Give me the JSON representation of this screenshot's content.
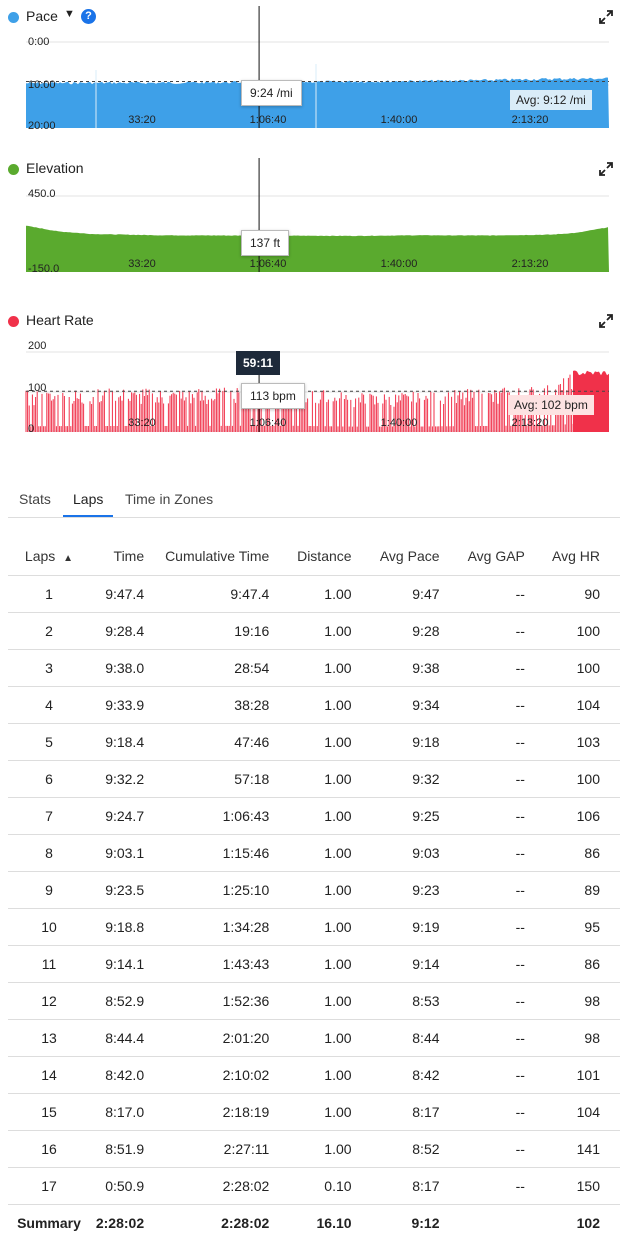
{
  "charts": {
    "pace": {
      "title": "Pace",
      "y_top": "0:00",
      "y_mid": "10:00",
      "y_bottom": "20:00",
      "tooltip": "9:24 /mi",
      "avg": "Avg: 9:12 /mi",
      "color": "#3ea0e8"
    },
    "elevation": {
      "title": "Elevation",
      "y_top": "450.0",
      "y_bottom": "-150.0",
      "tooltip": "137 ft",
      "color": "#5aaa2e"
    },
    "heart_rate": {
      "title": "Heart Rate",
      "y_top": "200",
      "y_mid": "100",
      "y_bottom": "0",
      "tooltip": "113 bpm",
      "avg": "Avg: 102 bpm",
      "cursor_time": "59:11",
      "color": "#f0314a"
    },
    "x_ticks": [
      "33:20",
      "1:06:40",
      "1:40:00",
      "2:13:20"
    ]
  },
  "chart_data": [
    {
      "type": "area",
      "title": "Pace",
      "ylabel": "",
      "ylim": [
        "0:00",
        "20:00"
      ],
      "y_ticks": [
        "0:00",
        "10:00",
        "20:00"
      ],
      "x_ticks": [
        "33:20",
        "1:06:40",
        "1:40:00",
        "2:13:20"
      ],
      "x_range": [
        "0:00",
        "2:28:02"
      ],
      "cursor_time": "59:11",
      "cursor_value": "9:24 /mi",
      "average": "9:12 /mi",
      "series": [
        {
          "name": "Pace",
          "x": [
            "0:00",
            "16:40",
            "33:20",
            "50:00",
            "1:06:40",
            "1:23:20",
            "1:40:00",
            "1:56:40",
            "2:13:20",
            "2:28:02"
          ],
          "values": [
            9.6,
            9.5,
            9.5,
            9.4,
            9.3,
            9.2,
            9.1,
            8.9,
            8.6,
            8.5
          ]
        }
      ]
    },
    {
      "type": "area",
      "title": "Elevation",
      "ylim": [
        -150,
        450
      ],
      "y_ticks": [
        "450.0",
        "-150.0"
      ],
      "x_ticks": [
        "33:20",
        "1:06:40",
        "1:40:00",
        "2:13:20"
      ],
      "cursor_value": "137 ft",
      "series": [
        {
          "name": "Elevation",
          "x": [
            "0:00",
            "8:20",
            "16:40",
            "33:20",
            "50:00",
            "1:06:40",
            "1:23:20",
            "1:40:00",
            "1:56:40",
            "2:13:20",
            "2:20:00",
            "2:28:02"
          ],
          "values": [
            215,
            170,
            150,
            140,
            138,
            137,
            135,
            140,
            138,
            145,
            160,
            205
          ]
        }
      ]
    },
    {
      "type": "area",
      "title": "Heart Rate",
      "ylim": [
        0,
        200
      ],
      "y_ticks": [
        "200",
        "100",
        "0"
      ],
      "x_ticks": [
        "33:20",
        "1:06:40",
        "1:40:00",
        "2:13:20"
      ],
      "cursor_time": "59:11",
      "cursor_value": "113 bpm",
      "average": "102 bpm",
      "series": [
        {
          "name": "Heart Rate",
          "x": [
            "0:00",
            "16:40",
            "33:20",
            "50:00",
            "1:06:40",
            "1:23:20",
            "1:40:00",
            "1:56:40",
            "2:13:20",
            "2:20:00",
            "2:28:02"
          ],
          "values": [
            95,
            100,
            100,
            102,
            104,
            90,
            92,
            100,
            110,
            140,
            150
          ]
        }
      ]
    }
  ],
  "tabs": [
    "Stats",
    "Laps",
    "Time in Zones"
  ],
  "table": {
    "headers": [
      "Laps",
      "Time",
      "Cumulative Time",
      "Distance",
      "Avg Pace",
      "Avg GAP",
      "Avg HR"
    ],
    "sort_indicator": "▲",
    "rows": [
      [
        "1",
        "9:47.4",
        "9:47.4",
        "1.00",
        "9:47",
        "--",
        "90"
      ],
      [
        "2",
        "9:28.4",
        "19:16",
        "1.00",
        "9:28",
        "--",
        "100"
      ],
      [
        "3",
        "9:38.0",
        "28:54",
        "1.00",
        "9:38",
        "--",
        "100"
      ],
      [
        "4",
        "9:33.9",
        "38:28",
        "1.00",
        "9:34",
        "--",
        "104"
      ],
      [
        "5",
        "9:18.4",
        "47:46",
        "1.00",
        "9:18",
        "--",
        "103"
      ],
      [
        "6",
        "9:32.2",
        "57:18",
        "1.00",
        "9:32",
        "--",
        "100"
      ],
      [
        "7",
        "9:24.7",
        "1:06:43",
        "1.00",
        "9:25",
        "--",
        "106"
      ],
      [
        "8",
        "9:03.1",
        "1:15:46",
        "1.00",
        "9:03",
        "--",
        "86"
      ],
      [
        "9",
        "9:23.5",
        "1:25:10",
        "1.00",
        "9:23",
        "--",
        "89"
      ],
      [
        "10",
        "9:18.8",
        "1:34:28",
        "1.00",
        "9:19",
        "--",
        "95"
      ],
      [
        "11",
        "9:14.1",
        "1:43:43",
        "1.00",
        "9:14",
        "--",
        "86"
      ],
      [
        "12",
        "8:52.9",
        "1:52:36",
        "1.00",
        "8:53",
        "--",
        "98"
      ],
      [
        "13",
        "8:44.4",
        "2:01:20",
        "1.00",
        "8:44",
        "--",
        "98"
      ],
      [
        "14",
        "8:42.0",
        "2:10:02",
        "1.00",
        "8:42",
        "--",
        "101"
      ],
      [
        "15",
        "8:17.0",
        "2:18:19",
        "1.00",
        "8:17",
        "--",
        "104"
      ],
      [
        "16",
        "8:51.9",
        "2:27:11",
        "1.00",
        "8:52",
        "--",
        "141"
      ],
      [
        "17",
        "0:50.9",
        "2:28:02",
        "0.10",
        "8:17",
        "--",
        "150"
      ]
    ],
    "summary": [
      "Summary",
      "2:28:02",
      "2:28:02",
      "16.10",
      "9:12",
      "",
      "102"
    ]
  }
}
